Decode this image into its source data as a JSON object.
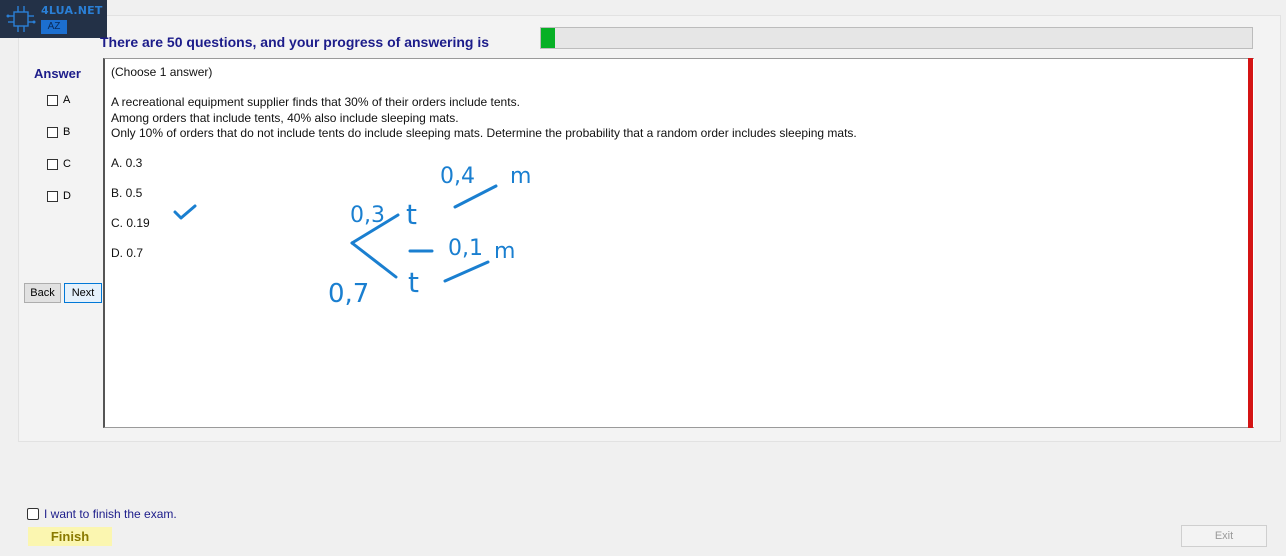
{
  "brand": {
    "site": "4LUA.NET",
    "tag": "AZ"
  },
  "progress": {
    "label": "There are 50 questions, and your progress of answering is",
    "fraction": 0.02,
    "color": "#06b025"
  },
  "answer_panel": {
    "title": "Answer",
    "options": [
      {
        "label": "A",
        "checked": false
      },
      {
        "label": "B",
        "checked": false
      },
      {
        "label": "C",
        "checked": false
      },
      {
        "label": "D",
        "checked": false
      }
    ],
    "back_label": "Back",
    "next_label": "Next"
  },
  "question": {
    "instruction": "(Choose 1 answer)",
    "lines": [
      "A recreational equipment supplier finds that 30% of their orders include tents.",
      "Among orders that include tents, 40% also include sleeping mats.",
      "Only 10% of orders that do not include tents do include sleeping mats. Determine the probability that a random order includes sleeping mats."
    ],
    "choices": [
      "A.  0.3",
      "B.  0.5",
      "C.  0.19",
      "D.  0.7"
    ]
  },
  "annotations": {
    "ink_color": "#1a7fd0",
    "labels": [
      "0,4",
      "m",
      "0,3",
      "t",
      "0,1",
      "m",
      "0,7",
      "t"
    ]
  },
  "footer": {
    "finish_check_label": "I want to finish the exam.",
    "finish_label": "Finish",
    "exit_label": "Exit"
  },
  "colors": {
    "accent_bar": "#d41414",
    "title_text": "#1c1c8a"
  }
}
